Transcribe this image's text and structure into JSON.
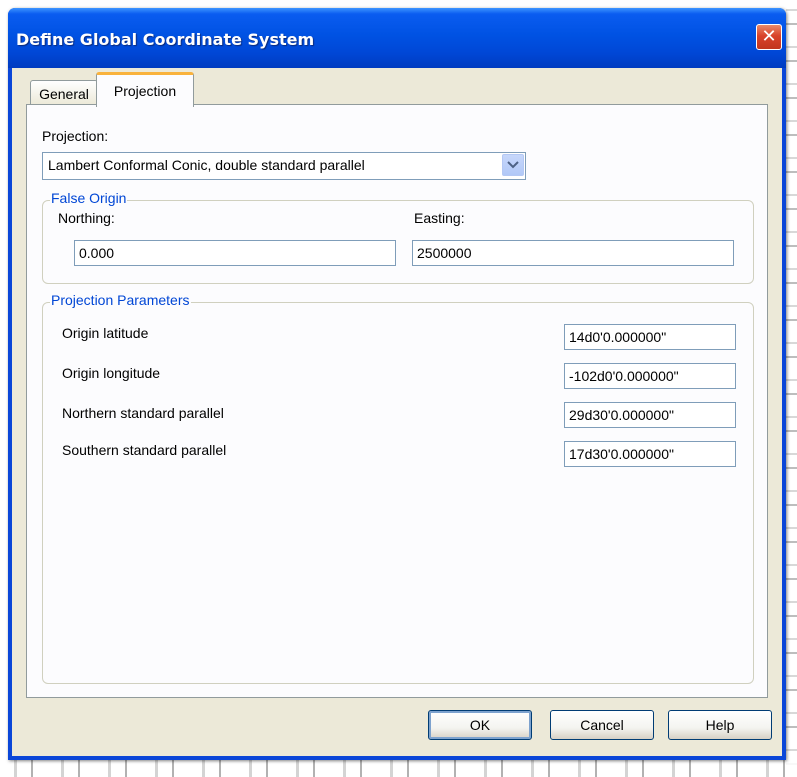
{
  "window": {
    "title": "Define Global Coordinate System",
    "close_glyph": "✕"
  },
  "tabs": [
    {
      "label": "General",
      "active": false
    },
    {
      "label": "Projection",
      "active": true
    }
  ],
  "projection": {
    "label": "Projection:",
    "selected": "Lambert Conformal Conic, double standard parallel",
    "dropdown_icon": "chevron-down-icon"
  },
  "false_origin": {
    "title": "False Origin",
    "northing_label": "Northing:",
    "northing_value": "0.000",
    "easting_label": "Easting:",
    "easting_value": "2500000"
  },
  "parameters": {
    "title": "Projection Parameters",
    "rows": [
      {
        "label": "Origin latitude",
        "value": "14d0'0.000000\""
      },
      {
        "label": "Origin longitude",
        "value": "-102d0'0.000000\""
      },
      {
        "label": "Northern standard parallel",
        "value": "29d30'0.000000\""
      },
      {
        "label": "Southern standard parallel",
        "value": "17d30'0.000000\""
      }
    ]
  },
  "buttons": {
    "ok": "OK",
    "cancel": "Cancel",
    "help": "Help"
  },
  "colors": {
    "titlebar": "#0052e3",
    "group_title": "#0046d5",
    "dialog_bg": "#ece9d8"
  }
}
